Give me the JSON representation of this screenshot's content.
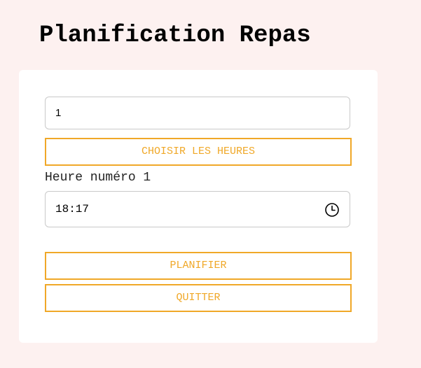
{
  "page": {
    "title": "Planification Repas"
  },
  "form": {
    "count_value": "1",
    "choose_button_label": "CHOISIR LES HEURES",
    "hours": [
      {
        "label": "Heure numéro 1",
        "value": "18:17"
      }
    ],
    "plan_button_label": "PLANIFIER",
    "quit_button_label": "QUITTER"
  },
  "colors": {
    "background": "#fdf1f0",
    "card": "#ffffff",
    "accent": "#f0a828",
    "field_border": "#c9c9c9"
  },
  "icons": {
    "time_picker": "clock-icon"
  }
}
